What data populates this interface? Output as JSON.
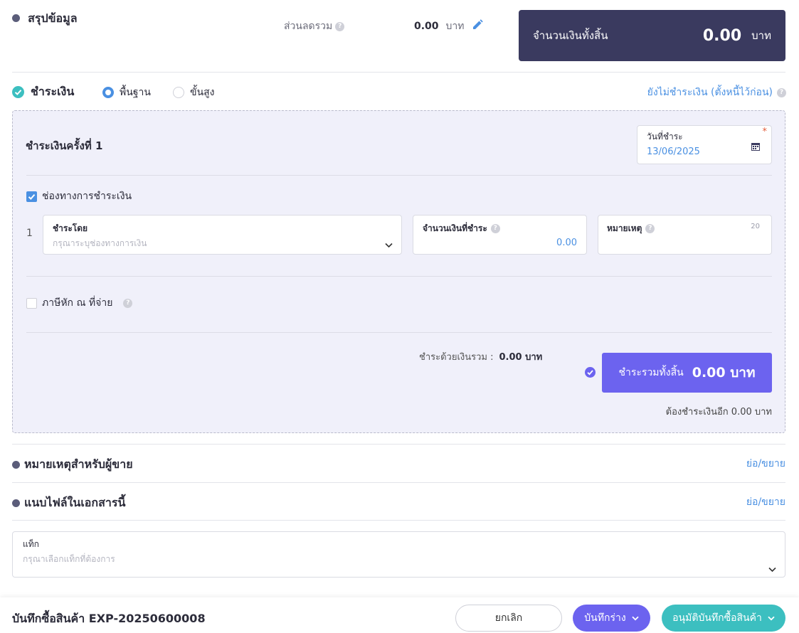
{
  "summary": {
    "title": "สรุปข้อมูล",
    "discount_label": "ส่วนลดรวม",
    "discount_value": "0.00",
    "discount_unit": "บาท",
    "grand_total_label": "จำนวนเงินทั้งสิ้น",
    "grand_total_value": "0.00",
    "grand_total_unit": "บาท"
  },
  "payment": {
    "title": "ชำระเงิน",
    "mode_basic": "พื้นฐาน",
    "mode_advanced": "ขั้นสูง",
    "unpaid_link": "ยังไม่ชำระเงิน (ตั้งหนี้ไว้ก่อน)",
    "installment_title": "ชำระเงินครั้งที่ 1",
    "date_label": "วันที่ชำระ",
    "date_value": "13/06/2025",
    "channel_checkbox_label": "ช่องทางการชำระเงิน",
    "row_index": "1",
    "pay_by_label": "ชำระโดย",
    "pay_by_placeholder": "กรุณาระบุช่องทางการเงิน",
    "amount_label": "จำนวนเงินที่ชำระ",
    "amount_value": "0.00",
    "note_label": "หมายเหตุ",
    "note_counter": "20",
    "withholding_label": "ภาษีหัก ณ ที่จ่าย",
    "paid_total_label": "ชำระด้วยเงินรวม :",
    "paid_total_value": "0.00 บาท",
    "total_button_label": "ชำระรวมทั้งสิ้น",
    "total_button_value": "0.00 บาท",
    "remaining_text": "ต้องชำระเงินอีก 0.00 บาท"
  },
  "seller_note": {
    "title": "หมายเหตุสำหรับผู้ขาย",
    "toggle": "ย่อ/ขยาย"
  },
  "attachments": {
    "title": "แนบไฟล์ในเอกสารนี้",
    "toggle": "ย่อ/ขยาย"
  },
  "tags": {
    "label": "แท็ก",
    "placeholder": "กรุณาเลือกแท็กที่ต้องการ"
  },
  "footer": {
    "doc_title": "บันทึกซื้อสินค้า EXP-20250600008",
    "cancel": "ยกเลิก",
    "save_draft": "บันทึกร่าง",
    "approve": "อนุมัติบันทึกซื้อสินค้า"
  },
  "colors": {
    "dark_panel": "#3a3a5f",
    "accent_purple": "#6c63ef",
    "teal": "#3cbfc0",
    "link_blue": "#4a90e2"
  }
}
